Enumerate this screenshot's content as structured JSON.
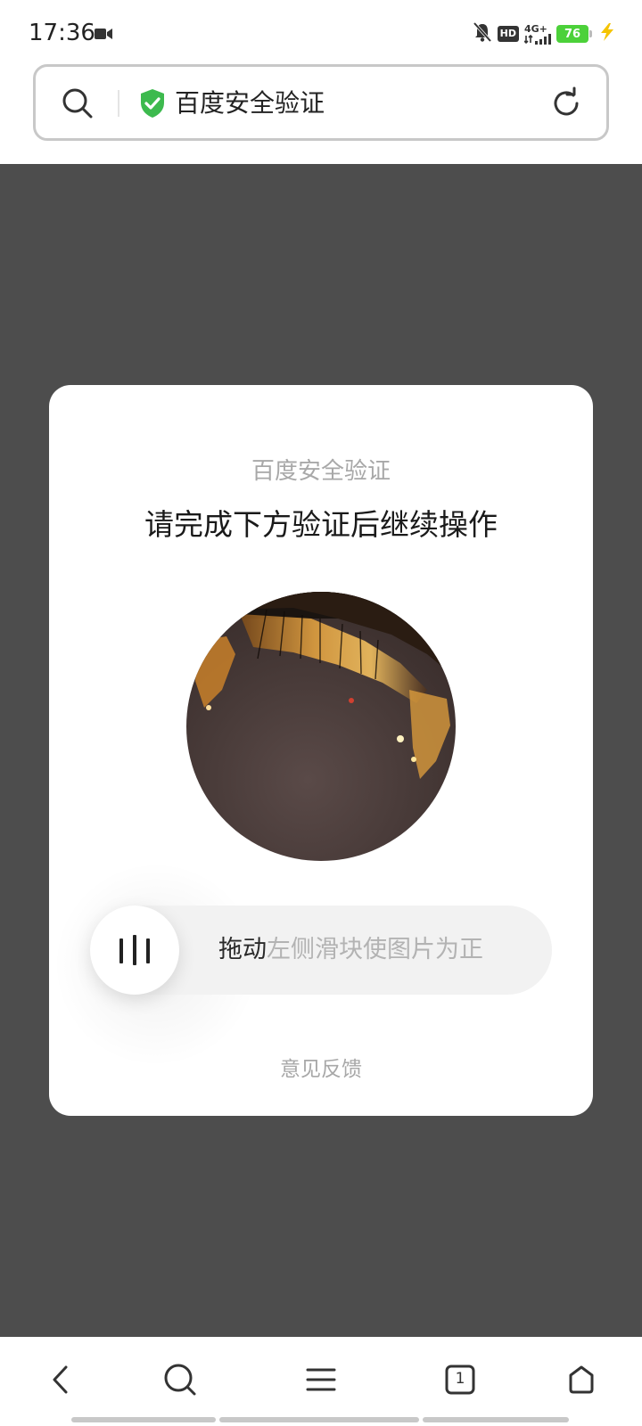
{
  "status_bar": {
    "time": "17:36",
    "hd_label": "HD",
    "network_label": "4G+",
    "battery_level": "76",
    "icons": [
      "video-camera-icon",
      "mute-bell-icon",
      "signal-icon",
      "charging-icon"
    ]
  },
  "address_bar": {
    "title": "百度安全验证",
    "icons": [
      "search-icon",
      "shield-check-icon",
      "reload-icon"
    ],
    "accent_color": "#3dba4e"
  },
  "dialog": {
    "subtitle": "百度安全验证",
    "title": "请完成下方验证后继续操作",
    "slider_hint_strong": "拖动",
    "slider_hint_rest": "左侧滑块使图片为正",
    "slider_progress": 0,
    "feedback_label": "意见反馈"
  },
  "bottom_nav": {
    "tab_count": "1",
    "icons": [
      "back-icon",
      "search-icon",
      "menu-icon",
      "tabs-icon",
      "home-icon"
    ]
  },
  "colors": {
    "overlay": "#4d4d4d",
    "card": "#ffffff",
    "battery": "#4cd13a",
    "charging": "#f5c400"
  }
}
